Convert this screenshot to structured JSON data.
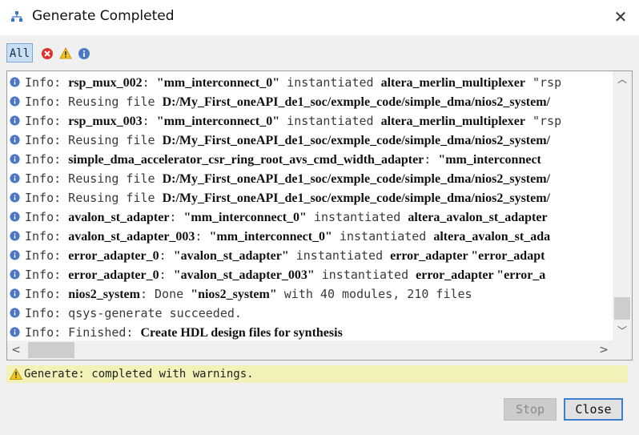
{
  "window": {
    "title": "Generate Completed",
    "close_icon": "close-icon"
  },
  "toolbar": {
    "all_label": "All",
    "icons": [
      "error-filter-icon",
      "warning-filter-icon",
      "info-filter-icon"
    ]
  },
  "log": {
    "rows": [
      {
        "segments": [
          {
            "t": "Info: "
          },
          {
            "t": "rsp_mux_002",
            "b": true
          },
          {
            "t": ": "
          },
          {
            "t": "\"mm_interconnect_0\"",
            "b": true
          },
          {
            "t": " instantiated "
          },
          {
            "t": "altera_merlin_multiplexer",
            "b": true
          },
          {
            "t": " \"rsp"
          }
        ]
      },
      {
        "segments": [
          {
            "t": "Info: Reusing file "
          },
          {
            "t": "D:/My_First_oneAPI_de1_soc/exmple_code/simple_dma/nios2_system/",
            "b": true
          }
        ]
      },
      {
        "segments": [
          {
            "t": "Info: "
          },
          {
            "t": "rsp_mux_003",
            "b": true
          },
          {
            "t": ": "
          },
          {
            "t": "\"mm_interconnect_0\"",
            "b": true
          },
          {
            "t": " instantiated "
          },
          {
            "t": "altera_merlin_multiplexer",
            "b": true
          },
          {
            "t": " \"rsp"
          }
        ]
      },
      {
        "segments": [
          {
            "t": "Info: Reusing file "
          },
          {
            "t": "D:/My_First_oneAPI_de1_soc/exmple_code/simple_dma/nios2_system/",
            "b": true
          }
        ]
      },
      {
        "segments": [
          {
            "t": "Info: "
          },
          {
            "t": "simple_dma_accelerator_csr_ring_root_avs_cmd_width_adapter",
            "b": true
          },
          {
            "t": ": "
          },
          {
            "t": "\"mm_interconnect",
            "b": true
          }
        ]
      },
      {
        "segments": [
          {
            "t": "Info: Reusing file "
          },
          {
            "t": "D:/My_First_oneAPI_de1_soc/exmple_code/simple_dma/nios2_system/",
            "b": true
          }
        ]
      },
      {
        "segments": [
          {
            "t": "Info: Reusing file "
          },
          {
            "t": "D:/My_First_oneAPI_de1_soc/exmple_code/simple_dma/nios2_system/",
            "b": true
          }
        ]
      },
      {
        "segments": [
          {
            "t": "Info: "
          },
          {
            "t": "avalon_st_adapter",
            "b": true
          },
          {
            "t": ": "
          },
          {
            "t": "\"mm_interconnect_0\"",
            "b": true
          },
          {
            "t": " instantiated "
          },
          {
            "t": "altera_avalon_st_adapter",
            "b": true
          }
        ]
      },
      {
        "segments": [
          {
            "t": "Info: "
          },
          {
            "t": "avalon_st_adapter_003",
            "b": true
          },
          {
            "t": ": "
          },
          {
            "t": "\"mm_interconnect_0\"",
            "b": true
          },
          {
            "t": " instantiated "
          },
          {
            "t": "altera_avalon_st_ada",
            "b": true
          }
        ]
      },
      {
        "segments": [
          {
            "t": "Info: "
          },
          {
            "t": "error_adapter_0",
            "b": true
          },
          {
            "t": ": "
          },
          {
            "t": "\"avalon_st_adapter\"",
            "b": true
          },
          {
            "t": " instantiated "
          },
          {
            "t": "error_adapter",
            "b": true
          },
          {
            "t": " \"error_adapt",
            "b": true
          }
        ]
      },
      {
        "segments": [
          {
            "t": "Info: "
          },
          {
            "t": "error_adapter_0",
            "b": true
          },
          {
            "t": ": "
          },
          {
            "t": "\"avalon_st_adapter_003\"",
            "b": true
          },
          {
            "t": " instantiated "
          },
          {
            "t": "error_adapter",
            "b": true
          },
          {
            "t": " \"error_a",
            "b": true
          }
        ]
      },
      {
        "segments": [
          {
            "t": "Info: "
          },
          {
            "t": "nios2_system",
            "b": true
          },
          {
            "t": ": Done "
          },
          {
            "t": "\"nios2_system\"",
            "b": true
          },
          {
            "t": " with 40 modules, 210 files"
          }
        ]
      },
      {
        "segments": [
          {
            "t": "Info: qsys-generate succeeded."
          }
        ]
      },
      {
        "segments": [
          {
            "t": "Info: Finished: "
          },
          {
            "t": "Create HDL design files for synthesis",
            "b": true
          }
        ]
      }
    ]
  },
  "status": {
    "text": "Generate: completed with warnings.",
    "icon": "warning-icon"
  },
  "buttons": {
    "stop_label": "Stop",
    "close_label": "Close"
  },
  "colors": {
    "accent": "#3c7fd1",
    "status_bg": "#f2f2b8",
    "info_blue": "#4a78c2"
  }
}
